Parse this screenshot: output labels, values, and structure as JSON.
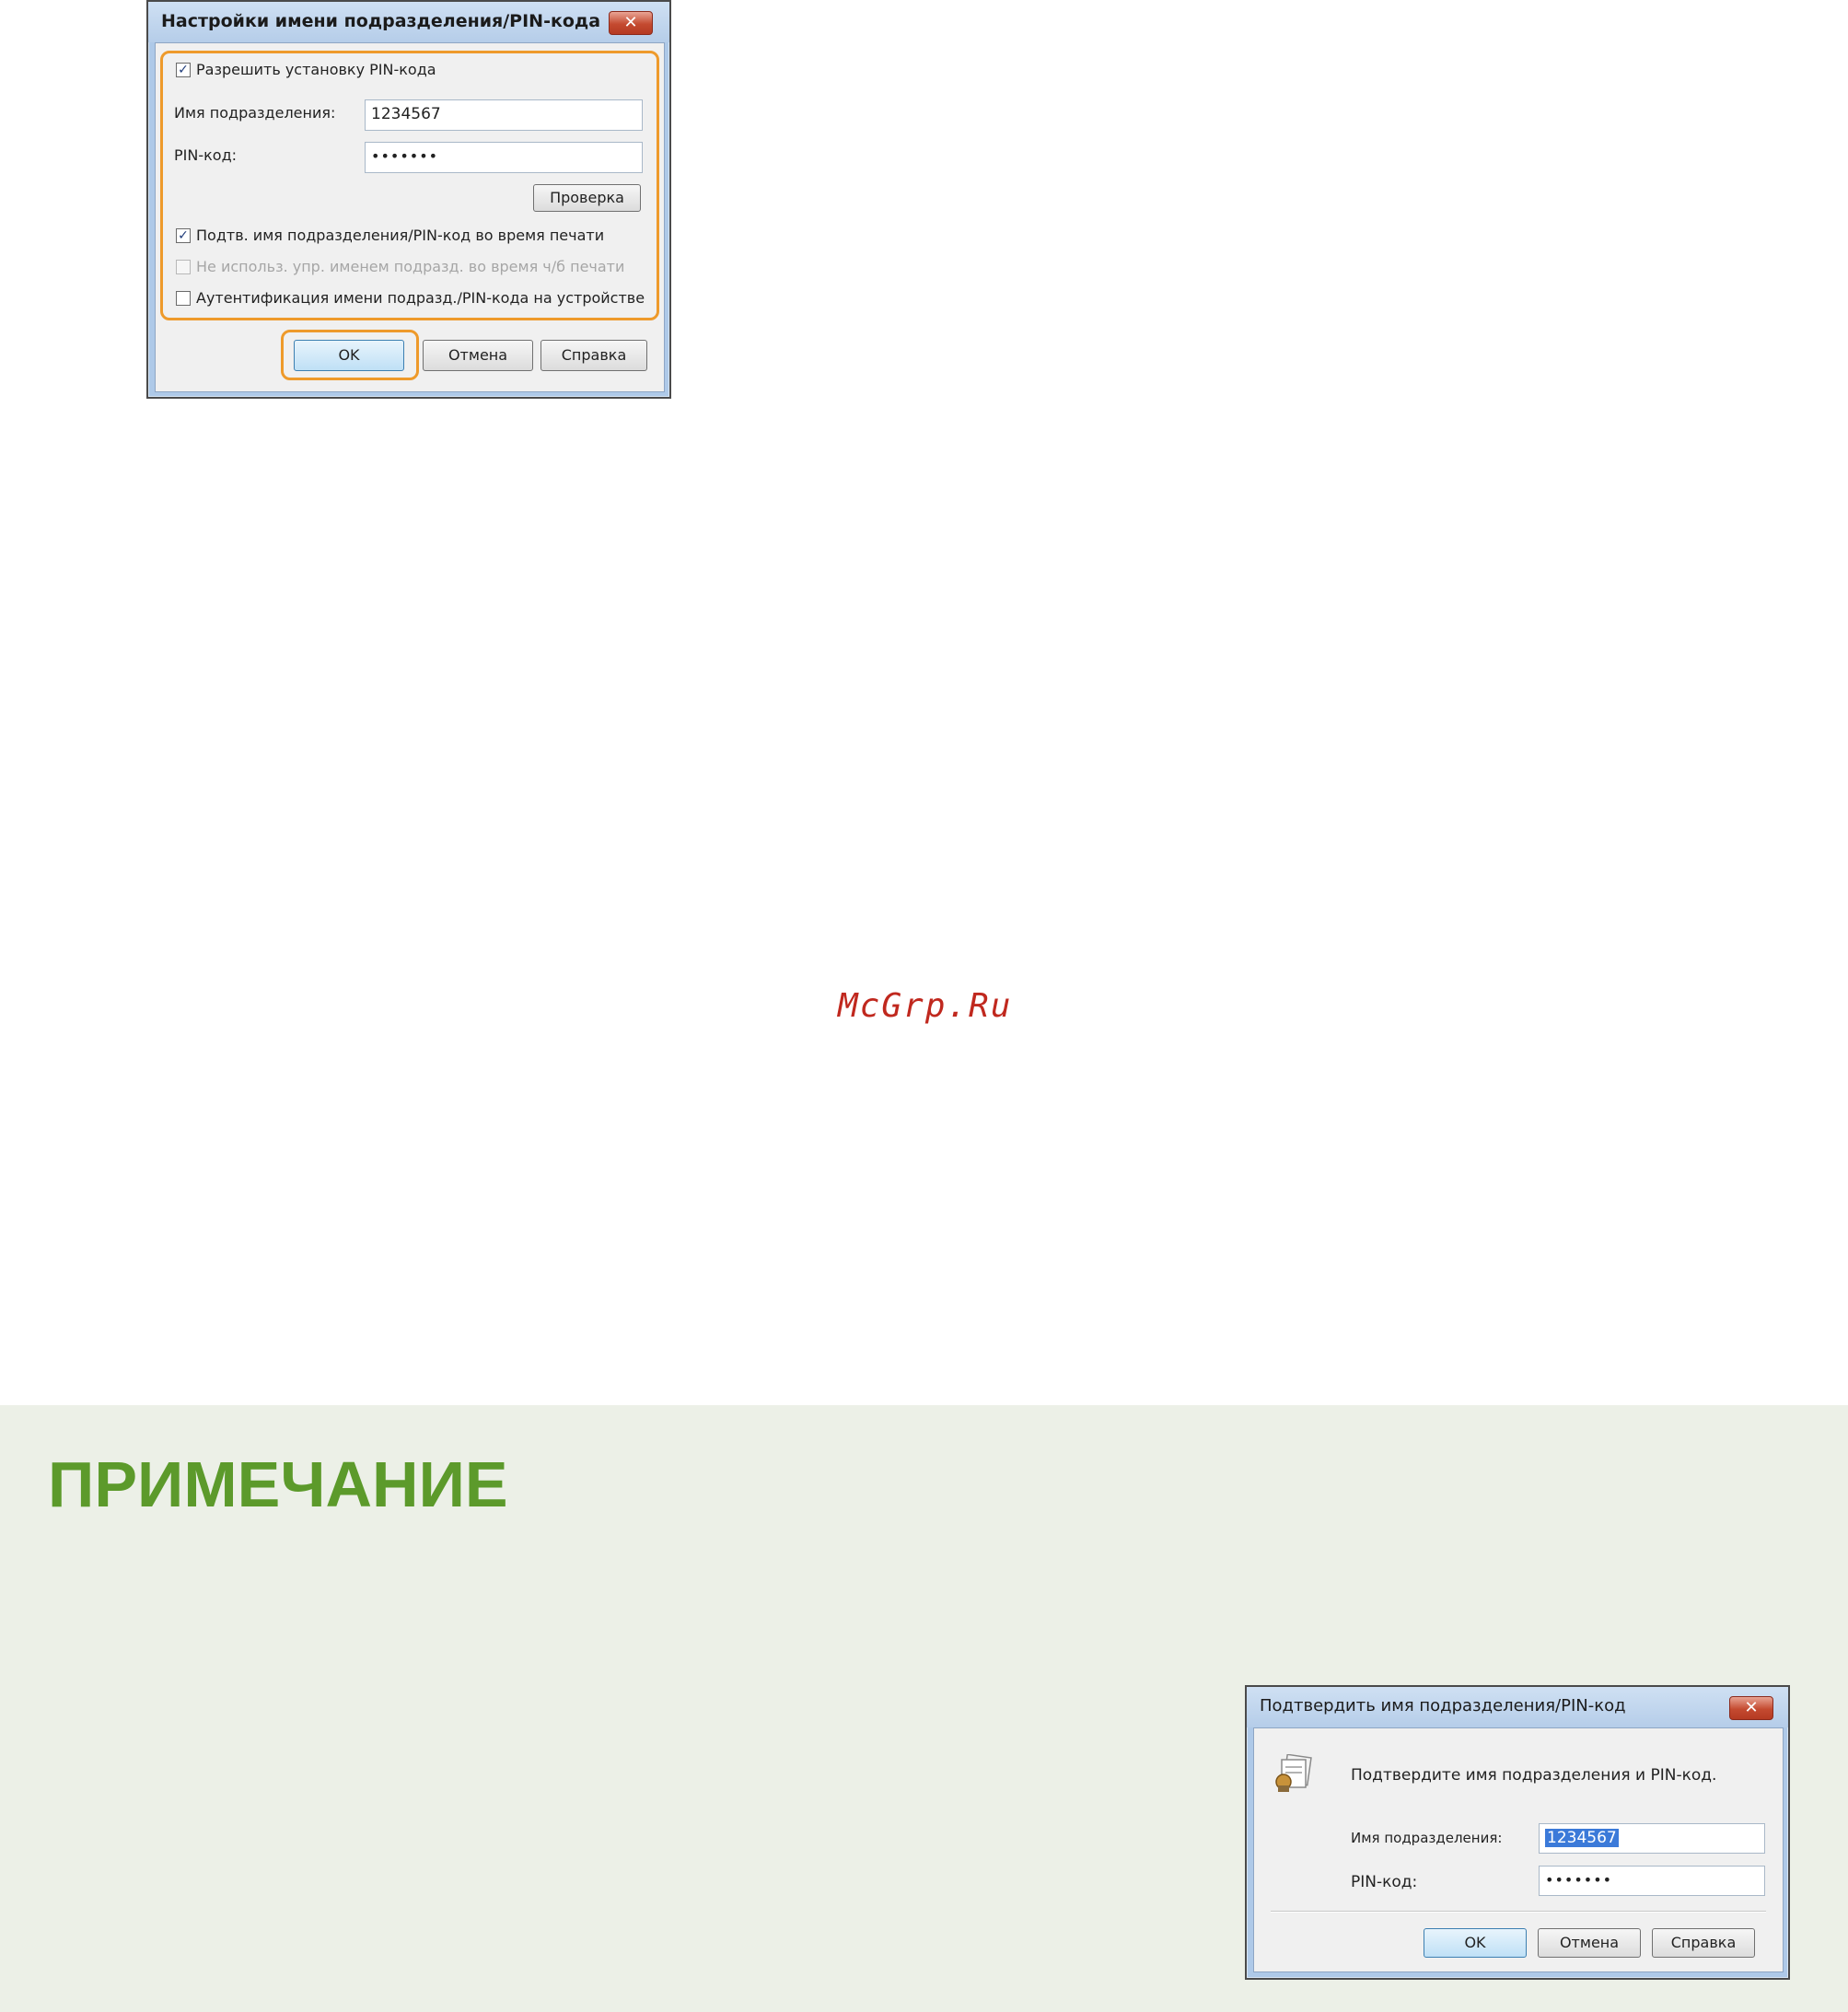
{
  "dialog1": {
    "title": "Настройки имени подразделения/PIN-кода",
    "close_glyph": "✕",
    "allow_pin_label": "Разрешить установку PIN-кода",
    "allow_pin_checked": true,
    "dept_label": "Имя подразделения:",
    "dept_value": "1234567",
    "pin_label": "PIN-код:",
    "pin_value": "•••••••",
    "verify_button": "Проверка",
    "confirm_label": "Подтв. имя подразделения/PIN-код во время печати",
    "confirm_checked": true,
    "no_bw_label": "Не использ. упр. именем подразд. во время ч/б печати",
    "no_bw_checked": false,
    "no_bw_disabled": true,
    "auth_label": "Аутентификация имени подразд./PIN-кода на устройстве",
    "auth_checked": false,
    "ok_button": "OK",
    "cancel_button": "Отмена",
    "help_button": "Справка"
  },
  "watermark": "McGrp.Ru",
  "note": {
    "title": "ПРИМЕЧАНИЕ"
  },
  "dialog2": {
    "title": "Подтвердить имя подразделения/PIN-код",
    "close_glyph": "✕",
    "icon": "department-id-icon",
    "message": "Подтвердите имя подразделения и PIN-код.",
    "dept_label": "Имя подразделения:",
    "dept_value": "1234567",
    "pin_label": "PIN-код:",
    "pin_value": "•••••••",
    "ok_button": "OK",
    "cancel_button": "Отмена",
    "help_button": "Справка"
  },
  "colors": {
    "highlight": "#ee9a2b",
    "note_title": "#5c9a2b",
    "note_background": "#ecf0e7",
    "watermark": "#c0281e"
  }
}
